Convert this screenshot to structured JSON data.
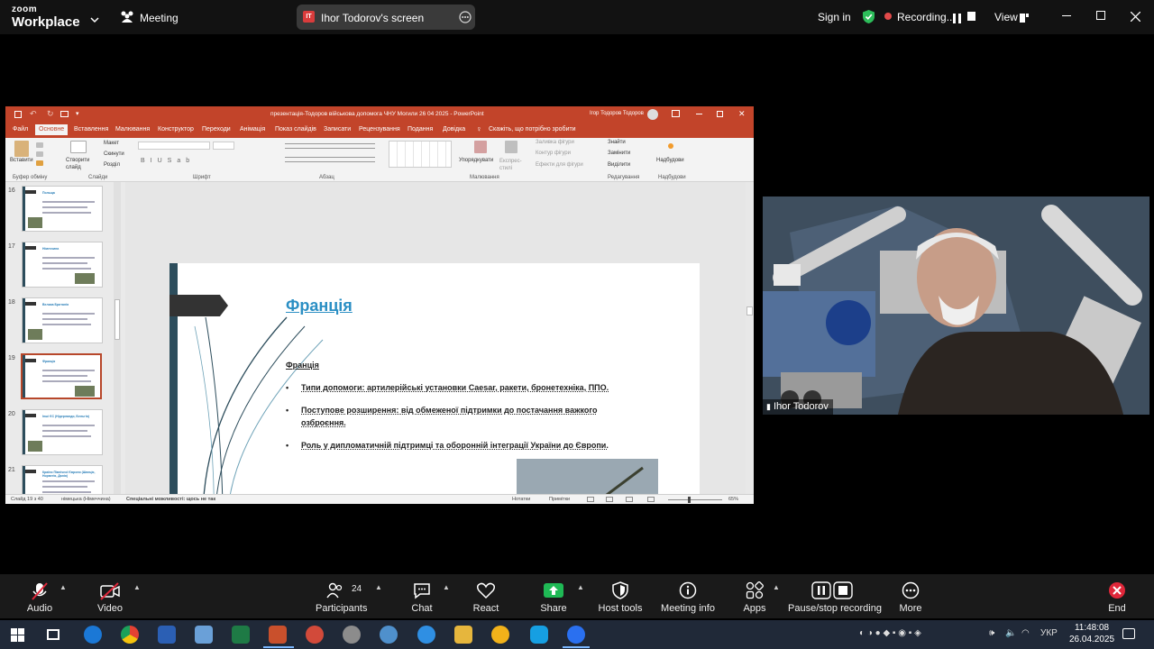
{
  "zoom": {
    "brand_top": "zoom",
    "brand_bottom": "Workplace",
    "meeting_label": "Meeting",
    "share_initials": "IT",
    "share_title": "Ihor Todorov's screen",
    "sign_in": "Sign in",
    "recording_label": "Recording...",
    "view_label": "View"
  },
  "ppt": {
    "window_title": "презентація-Тодоров військова допомога ЧНУ Могили 26 04 2025  -  PowerPoint",
    "user_name": "Ігор Тодоров Тодоров",
    "tabs": [
      "Файл",
      "Основне",
      "Вставлення",
      "Малювання",
      "Конструктор",
      "Переходи",
      "Анімація",
      "Показ слайдів",
      "Записати",
      "Рецензування",
      "Подання",
      "Довідка"
    ],
    "active_tab": 1,
    "tell_me": "Скажіть, що потрібно зробити",
    "ribbon_groups": [
      "Буфер обміну",
      "Слайди",
      "Шрифт",
      "Абзац",
      "Малювання",
      "Редагування",
      "Надбудови"
    ],
    "ribbon_labels": {
      "paste": "Вставити",
      "new_slide": "Створити слайд",
      "layout": "Макет",
      "reset": "Скинути",
      "section": "Розділ",
      "arrange": "Упорядкувати",
      "quick_styles": "Експрес-стилі",
      "fill": "Заливка фігури",
      "outline": "Контур фігури",
      "effects": "Ефекти для фігури",
      "find": "Знайти",
      "replace": "Замінити",
      "select": "Виділити",
      "addins": "Надбудови"
    },
    "thumbnails": [
      {
        "num": "16",
        "title": "Польща"
      },
      {
        "num": "17",
        "title": "Німеччина"
      },
      {
        "num": "18",
        "title": "Велика Британія"
      },
      {
        "num": "19",
        "title": "Франція"
      },
      {
        "num": "20",
        "title": "Інші ЄС (Нідерланди, Бельгія)"
      },
      {
        "num": "21",
        "title": "Країни Північної Європи (Швеція, Норвегія, Данія)"
      }
    ],
    "selected_thumb": 3,
    "status_slide": "Слайд 19 з 40",
    "status_lang": "німецька (Німеччина)",
    "status_access": "Спеціальні можливості: щось не так",
    "status_notes": "Нотатки",
    "status_comments": "Примітки",
    "status_zoom": "65%"
  },
  "slide": {
    "title": "Франція",
    "subtitle": "Франція",
    "bullets": [
      "Типи допомоги: артилерійські установки Caesar, ракети, бронетехніка, ППО.",
      "Поступове розширення: від обмеженої підтримки до постачання важкого озброєння.",
      "Роль у дипломатичній підтримці та оборонній інтеграції України до Європи."
    ]
  },
  "video": {
    "participant_name": "Ihor Todorov"
  },
  "toolbar": {
    "audio": "Audio",
    "video": "Video",
    "participants": "Participants",
    "participants_count": "24",
    "chat": "Chat",
    "react": "React",
    "share": "Share",
    "host_tools": "Host tools",
    "meeting_info": "Meeting info",
    "apps": "Apps",
    "recording": "Pause/stop recording",
    "more": "More",
    "end": "End"
  },
  "taskbar": {
    "language": "УКР",
    "time": "11:48:08",
    "date": "26.04.2025"
  },
  "colors": {
    "ppt_accent": "#c2442a",
    "slide_title": "#2b8fc4",
    "slide_strip": "#2d4d5c",
    "recording_green": "#2dbd5a",
    "share_green": "#1fb955",
    "end_red": "#e0273a",
    "taskbar": "#202938"
  }
}
